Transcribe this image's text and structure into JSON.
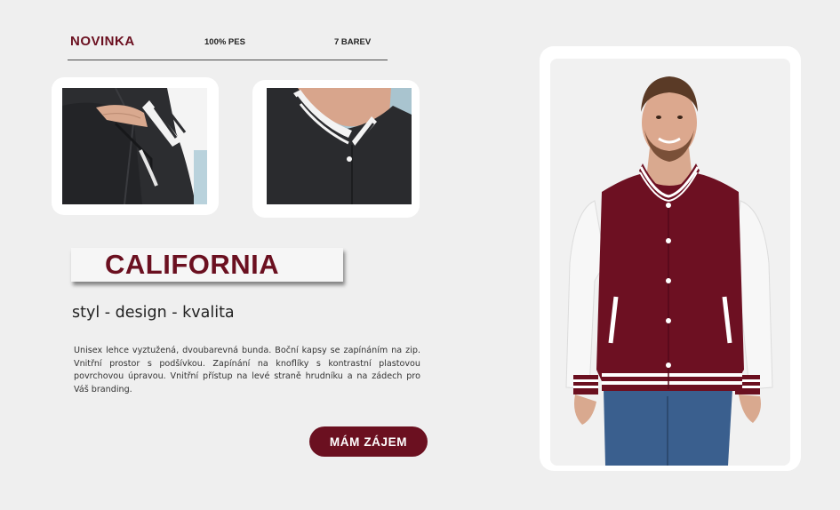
{
  "header": {
    "badge": "NOVINKA",
    "material": "100% PES",
    "colors": "7 BAREV"
  },
  "product": {
    "title": "CALIFORNIA",
    "tagline": "styl - design - kvalita",
    "description": "Unisex lehce vyztužená, dvoubarevná bunda. Boční kapsy se zapínáním na zip. Vnitřní prostor s podšívkou. Zapínání na knoflíky s kontrastní plastovou povrchovou úpravou. Vnitřní přístup na levé straně hrudníku a na zádech pro Váš branding.",
    "cta_label": "MÁM ZÁJEM"
  },
  "colors": {
    "brand": "#6b1020",
    "background": "#efefef",
    "card": "#ffffff"
  }
}
